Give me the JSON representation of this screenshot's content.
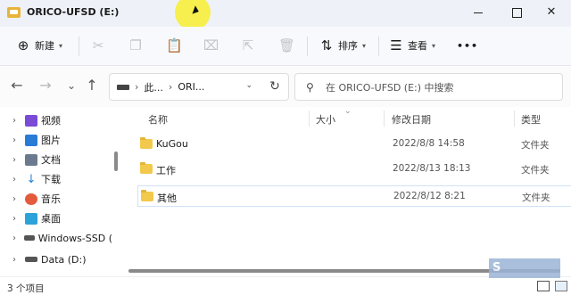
{
  "window": {
    "title": "ORICO-UFSD (E:)",
    "buttons": {
      "minimize": "—",
      "maximize": "☐",
      "close": "✕"
    }
  },
  "toolbar": {
    "new_label": "新建",
    "sort_label": "排序",
    "view_label": "查看",
    "more_label": "•••"
  },
  "address": {
    "crumbs": [
      "此...",
      "ORI..."
    ],
    "separator": "›"
  },
  "search": {
    "placeholder": "在 ORICO-UFSD (E:) 中搜索"
  },
  "sidebar": {
    "items": [
      {
        "label": "视频",
        "icon": "video-icon",
        "color": "#7a4bd6"
      },
      {
        "label": "图片",
        "icon": "picture-icon",
        "color": "#2a7bd6"
      },
      {
        "label": "文档",
        "icon": "document-icon",
        "color": "#6b7a8f"
      },
      {
        "label": "下载",
        "icon": "download-icon",
        "color": "#1f7fd8"
      },
      {
        "label": "音乐",
        "icon": "music-icon",
        "color": "#e35b3c"
      },
      {
        "label": "桌面",
        "icon": "desktop-icon",
        "color": "#2ba2d8"
      },
      {
        "label": "Windows-SSD (",
        "icon": "drive-icon",
        "color": "#555555"
      },
      {
        "label": "Data (D:)",
        "icon": "drive-icon",
        "color": "#555555"
      }
    ]
  },
  "columns": {
    "name": "名称",
    "size": "大小",
    "modified": "修改日期",
    "type": "类型"
  },
  "files": [
    {
      "name": "KuGou",
      "date": "2022/8/8 14:58",
      "type": "文件夹"
    },
    {
      "name": "工作",
      "date": "2022/8/13 18:13",
      "type": "文件夹"
    },
    {
      "name": "其他",
      "date": "2022/8/12 8:21",
      "type": "文件夹"
    }
  ],
  "status": {
    "count": "3 个项目"
  },
  "watermark": "S"
}
